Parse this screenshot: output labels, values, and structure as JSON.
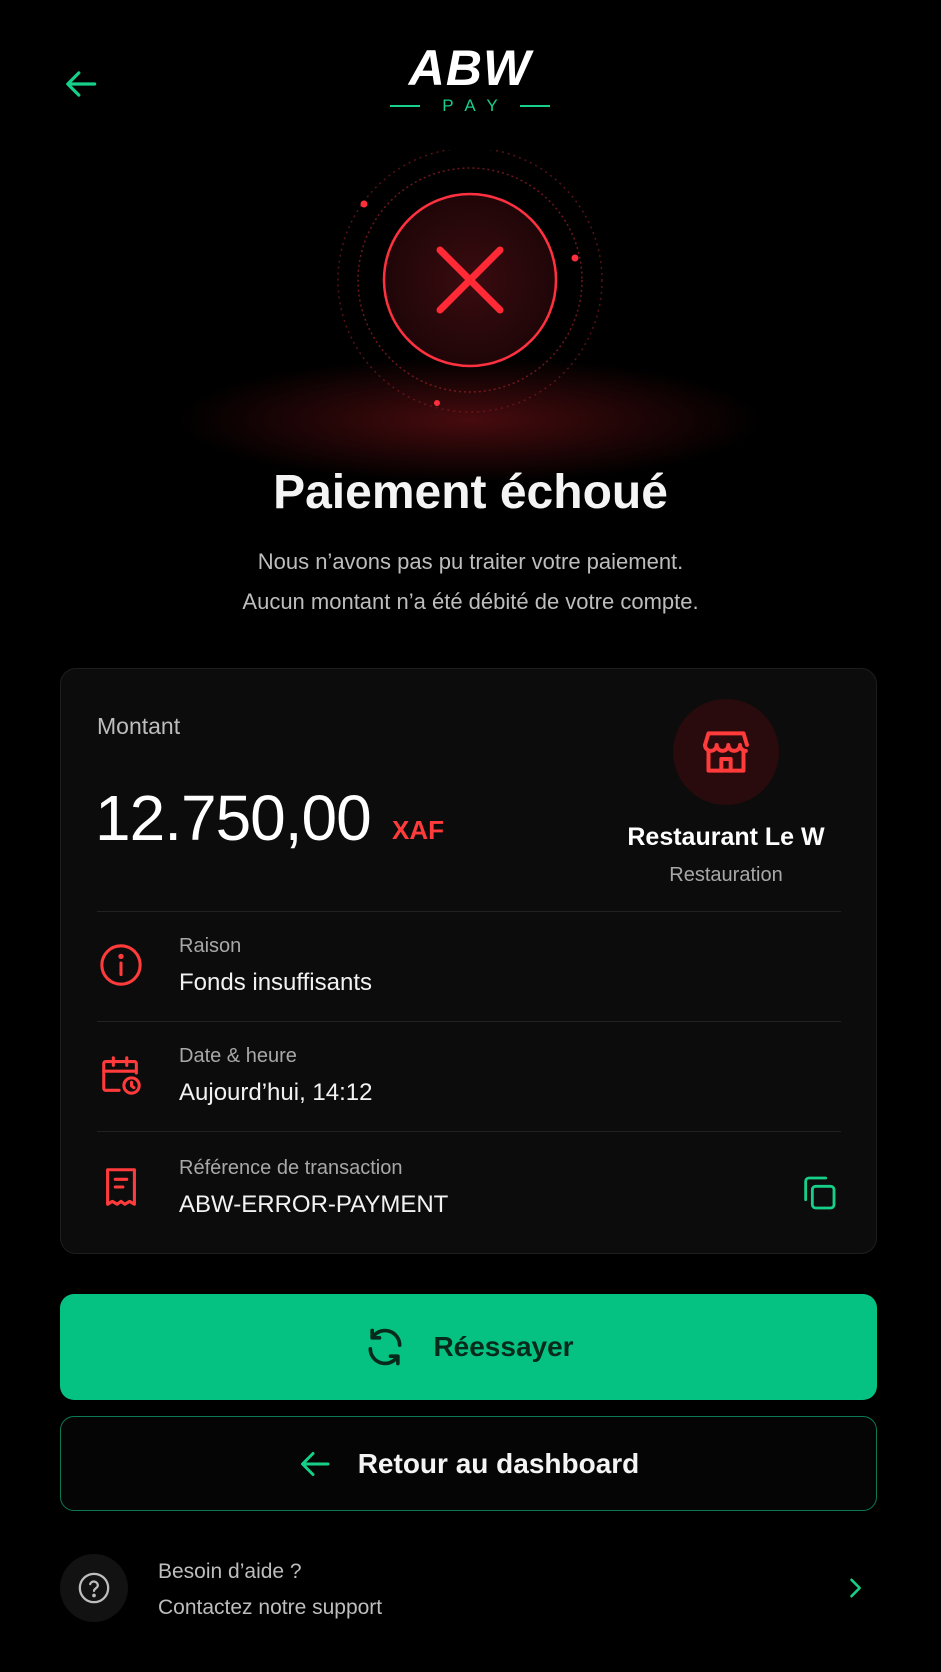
{
  "brand": {
    "logo_text": "ABW",
    "logo_sub": "PAY"
  },
  "status": {
    "title": "Paiement échoué",
    "line1": "Nous n’avons pas pu traiter votre paiement.",
    "line2": "Aucun montant n’a été débité de votre compte."
  },
  "card": {
    "amount_label": "Montant",
    "amount": "12.750,00",
    "currency": "XAF",
    "merchant_name": "Restaurant Le W",
    "merchant_category": "Restauration",
    "details": [
      {
        "label": "Raison",
        "value": "Fonds insuffisants",
        "icon": "info-icon"
      },
      {
        "label": "Date & heure",
        "value": "Aujourd’hui, 14:12",
        "icon": "calendar-clock-icon"
      },
      {
        "label": "Référence de transaction",
        "value": "ABW-ERROR-PAYMENT",
        "icon": "receipt-icon"
      }
    ]
  },
  "actions": {
    "retry_label": "Réessayer",
    "back_label": "Retour au dashboard"
  },
  "help": {
    "title": "Besoin d’aide ?",
    "subtitle": "Contactez notre support"
  },
  "colors": {
    "accent": "#05c283",
    "error": "#ff3b3b",
    "background": "#000000"
  }
}
